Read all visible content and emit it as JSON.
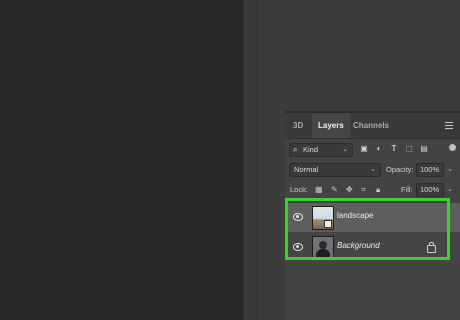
{
  "tabs": [
    {
      "label": "3D"
    },
    {
      "label": "Layers"
    },
    {
      "label": "Channels"
    }
  ],
  "filter": {
    "kind_label": "Kind"
  },
  "blend": {
    "mode": "Normal",
    "opacity_label": "Opacity:",
    "opacity_value": "100%"
  },
  "lock": {
    "label": "Lock:",
    "fill_label": "Fill:",
    "fill_value": "100%"
  },
  "layers": [
    {
      "name": "landscape",
      "selected": true
    },
    {
      "name": "Background",
      "locked": true
    }
  ],
  "colors": {
    "highlight": "#36d42c",
    "panel_bg": "#434343",
    "selected_row": "#5a5a5a"
  }
}
